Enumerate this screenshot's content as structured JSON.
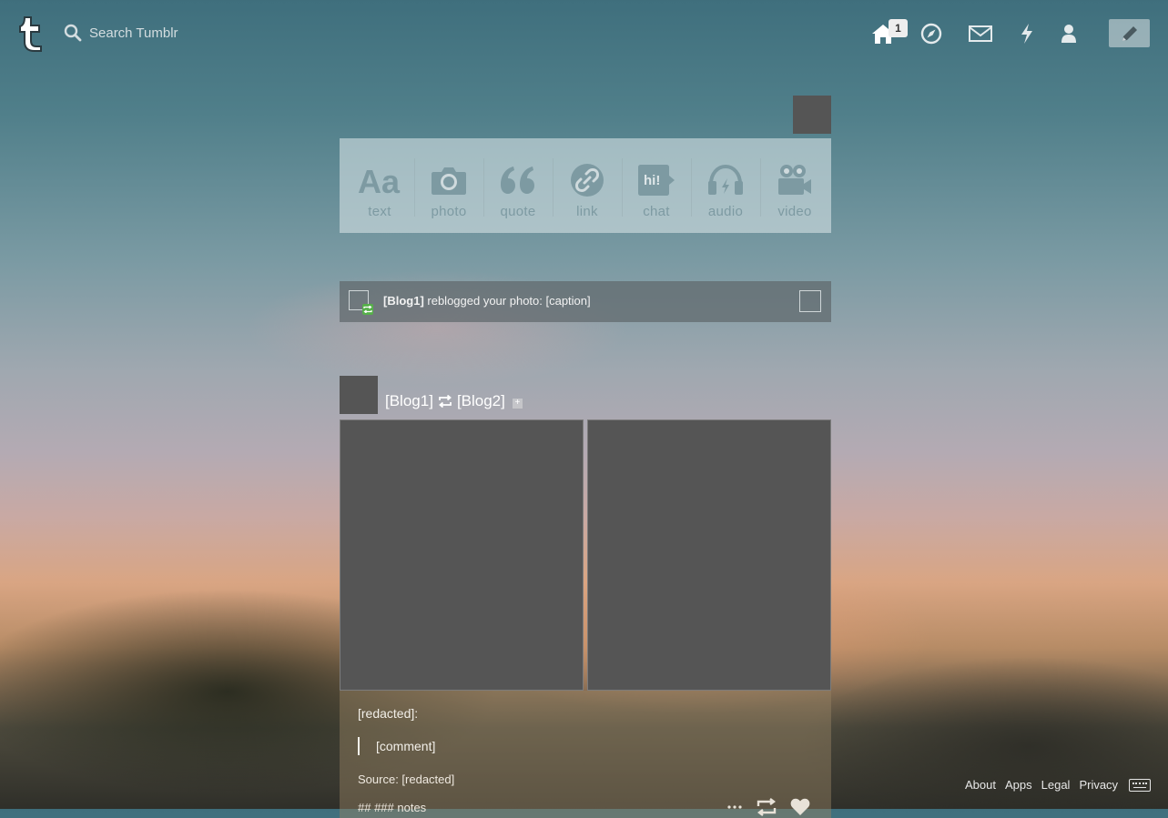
{
  "topbar": {
    "search_placeholder": "Search Tumblr",
    "inbox_badge": "1",
    "nav": [
      "home-icon",
      "explore-icon",
      "inbox-icon",
      "activity-icon",
      "account-icon",
      "pencil-icon"
    ]
  },
  "post_types": [
    {
      "label": "text",
      "icon": "text-icon"
    },
    {
      "label": "photo",
      "icon": "camera-icon"
    },
    {
      "label": "quote",
      "icon": "quote-icon"
    },
    {
      "label": "link",
      "icon": "link-icon"
    },
    {
      "label": "chat",
      "icon": "chat-icon"
    },
    {
      "label": "audio",
      "icon": "headphones-icon"
    },
    {
      "label": "video",
      "icon": "video-camera-icon"
    }
  ],
  "notification": {
    "blog": "[Blog1]",
    "text": " reblogged your photo: [caption]"
  },
  "post": {
    "from_blog": "[Blog1]",
    "to_blog": "[Blog2]",
    "commenter": "[redacted]:",
    "comment": "[comment]",
    "source": "Source: [redacted]",
    "notes": "## ### notes"
  },
  "footer": {
    "links": [
      "About",
      "Apps",
      "Legal",
      "Privacy"
    ]
  },
  "colors": {
    "panel_text": "#7d9aa2",
    "placeholder_box": "#555555",
    "reblog_green": "#56b04a"
  }
}
